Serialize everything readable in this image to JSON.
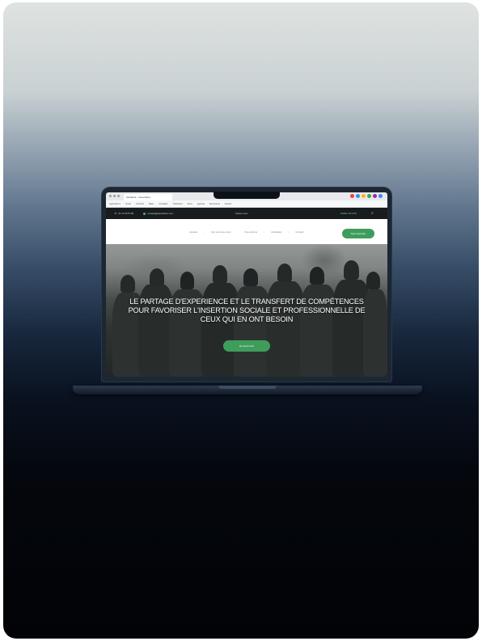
{
  "browser": {
    "tab_title": "Solidarité · Association",
    "bookmarks": [
      "Applications",
      "Gmail",
      "YouTube",
      "Maps",
      "Actualités",
      "Traduction",
      "Drive",
      "Agenda",
      "Documents",
      "Favoris"
    ],
    "extension_colors": [
      "#ea4335",
      "#4285f4",
      "#fbbc05",
      "#34a853",
      "#9c27b0",
      "#4285f4"
    ]
  },
  "site": {
    "topbar": {
      "phone": "01 23 45 67 89",
      "email": "contact@association.com",
      "social": "Suivez-nous",
      "donate": "FAIRE UN DON",
      "search_icon": "search-icon"
    },
    "nav": {
      "items": [
        "Accueil",
        "Qui sommes-nous",
        "Nos actions",
        "Actualités",
        "Contact"
      ],
      "active_index": 0,
      "cta": "Nous rejoindre"
    },
    "hero": {
      "headline": "LE PARTAGE D'EXPERIENCE ET LE TRANSFERT DE COMPÉTENCES\nPOUR FAVORISER L'INSERTION SOCIALE ET PROFESSIONNELLE DE\nCEUX QUI EN ONT BESOIN",
      "button": "En savoir plus"
    }
  },
  "colors": {
    "accent": "#3f9d5c",
    "topbar_bg": "#181c1e",
    "laptop_body": "#1c2733"
  }
}
